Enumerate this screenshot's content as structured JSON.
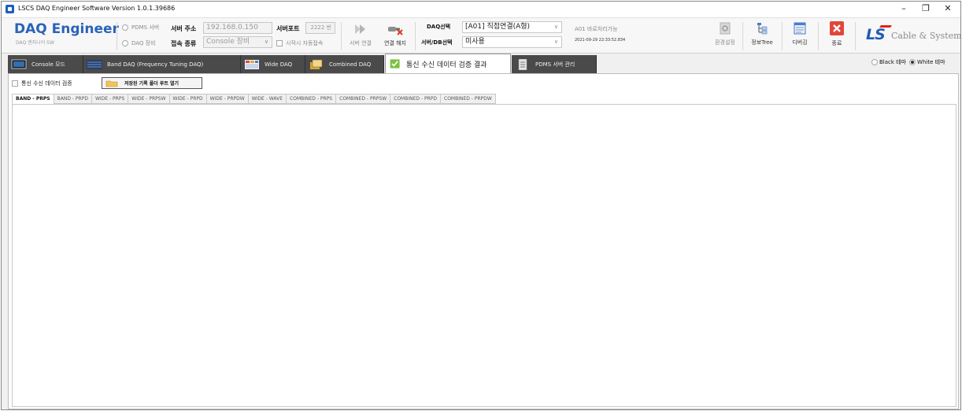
{
  "window": {
    "title": "LSCS DAQ Engineer Software Version 1.0.1.39686",
    "controls": [
      "–",
      "❐",
      "✕"
    ]
  },
  "brand": {
    "title": "DAQ Engineer",
    "subtitle": "DAQ 엔지니어 SW"
  },
  "server": {
    "mode_options": [
      {
        "label": "PDMS 서버",
        "selected": false
      },
      {
        "label": "DAQ 장비",
        "selected": false
      }
    ],
    "address_label": "서버 주소",
    "address_value": "192.168.0.150",
    "port_label": "서버포트",
    "port_value": "2222 번",
    "conn_type_label": "접속 종류",
    "conn_type_value": "Console 장비",
    "auto_connect_label": "시작시 자동접속",
    "auto_connect_checked": false
  },
  "actions": {
    "connect_label": "서버 연결",
    "disconnect_label": "연결 해지"
  },
  "daq": {
    "select_label": "DAQ선택",
    "select_value": "[A01] 직접연결(A형)",
    "db_label": "서버/DB선택",
    "db_value": "미사용",
    "status_text": "A01 바로처리가능",
    "timestamp": "2021-09-29 22:33:52.834"
  },
  "tools": {
    "env_label": "환경설정",
    "tree_label": "정보Tree",
    "debug_label": "디버깅",
    "exit_label": "종료"
  },
  "logo": {
    "ls": "LS",
    "text": "Cable & System"
  },
  "main_tabs": [
    {
      "label": "Console 모드",
      "icon": "monitor-icon",
      "active": false
    },
    {
      "label": "Band DAQ (Frequency Tuning DAQ)",
      "icon": "band-wave-icon",
      "active": false
    },
    {
      "label": "Wide DAQ",
      "icon": "grid-chart-icon",
      "active": false
    },
    {
      "label": "Combined DAQ",
      "icon": "combined-icon",
      "active": false
    },
    {
      "label": "통신 수신 데이터 검증 결과",
      "icon": "check-icon",
      "active": true
    },
    {
      "label": "PDMS 서버 관리",
      "icon": "server-icon",
      "active": false
    }
  ],
  "theme": {
    "options": [
      {
        "label": "Black 테마",
        "selected": false
      },
      {
        "label": "White 테마",
        "selected": true
      }
    ]
  },
  "content": {
    "verify_checkbox_label": "통신 수신 데이터 검증",
    "verify_checked": false,
    "open_folder_label": "저장된 기록 폴더 루트 열기",
    "sub_tabs": [
      "BAND - PRPS",
      "BAND - PRPD",
      "WIDE - PRPS",
      "WIDE - PRPSW",
      "WIDE - PRPD",
      "WIDE - PRPDW",
      "WIDE - WAVE",
      "COMBINED - PRPS",
      "COMBINED - PRPSW",
      "COMBINED - PRPD",
      "COMBINED - PRPDW"
    ],
    "active_sub_tab": "BAND - PRPS"
  },
  "colors": {
    "brand_blue": "#2b63b8",
    "tab_dark": "#4a4a4a",
    "exit_red": "#e2463b",
    "ls_red": "#e2231a"
  }
}
